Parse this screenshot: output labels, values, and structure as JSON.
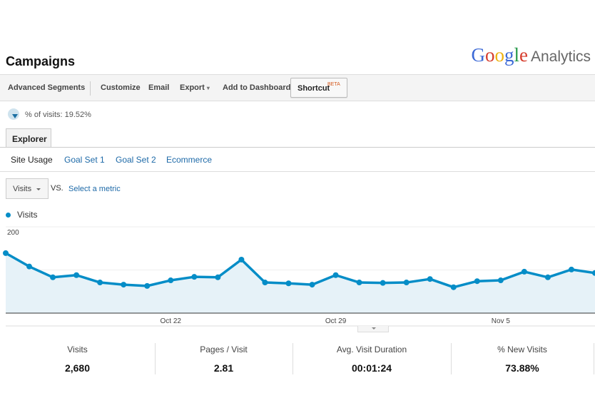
{
  "page": {
    "title": "Campaigns"
  },
  "logo": {
    "google": [
      "G",
      "o",
      "o",
      "g",
      "l",
      "e"
    ],
    "product": "Analytics",
    "google_colors": [
      "#3c69d6",
      "#d63c2c",
      "#eeb211",
      "#3c69d6",
      "#27994a",
      "#d63c2c"
    ]
  },
  "toolbar": {
    "advanced_segments": "Advanced Segments",
    "customize": "Customize",
    "email": "Email",
    "export": "Export",
    "add_to_dashboard": "Add to Dashboard",
    "shortcut": "Shortcut",
    "shortcut_badge": "BETA"
  },
  "segment": {
    "icon": "pie-segment-icon",
    "text": "% of visits: 19.52%"
  },
  "tabs": [
    {
      "label": "Explorer",
      "active": true
    }
  ],
  "subtabs": [
    {
      "label": "Site Usage",
      "active": true
    },
    {
      "label": "Goal Set 1"
    },
    {
      "label": "Goal Set 2"
    },
    {
      "label": "Ecommerce"
    }
  ],
  "metric_selector": {
    "selected": "Visits",
    "vs_label": "VS.",
    "compare_placeholder": "Select a metric"
  },
  "legend": {
    "series_label": "Visits",
    "color": "#058dc7"
  },
  "chart_data": {
    "type": "area",
    "title": "",
    "xlabel": "",
    "ylabel": "",
    "ylim": [
      0,
      200
    ],
    "yticks": [
      100,
      200
    ],
    "grid": true,
    "legend": "top-left",
    "x_tick_labels": [
      {
        "index": 7,
        "label": "Oct 22"
      },
      {
        "index": 14,
        "label": "Oct 29"
      },
      {
        "index": 21,
        "label": "Nov 5"
      }
    ],
    "x": [
      "Oct 15",
      "Oct 16",
      "Oct 17",
      "Oct 18",
      "Oct 19",
      "Oct 20",
      "Oct 21",
      "Oct 22",
      "Oct 23",
      "Oct 24",
      "Oct 25",
      "Oct 26",
      "Oct 27",
      "Oct 28",
      "Oct 29",
      "Oct 30",
      "Oct 31",
      "Nov 1",
      "Nov 2",
      "Nov 3",
      "Nov 4",
      "Nov 5",
      "Nov 6",
      "Nov 7",
      "Nov 8",
      "Nov 9"
    ],
    "series": [
      {
        "name": "Visits",
        "color": "#058dc7",
        "values": [
          139,
          108,
          83,
          88,
          71,
          66,
          63,
          76,
          84,
          83,
          124,
          71,
          69,
          66,
          88,
          71,
          70,
          71,
          79,
          60,
          74,
          76,
          96,
          83,
          101,
          93
        ]
      }
    ]
  },
  "stats": [
    {
      "label": "Visits",
      "value": "2,680"
    },
    {
      "label": "Pages / Visit",
      "value": "2.81"
    },
    {
      "label": "Avg. Visit Duration",
      "value": "00:01:24"
    },
    {
      "label": "% New Visits",
      "value": "73.88%"
    }
  ]
}
